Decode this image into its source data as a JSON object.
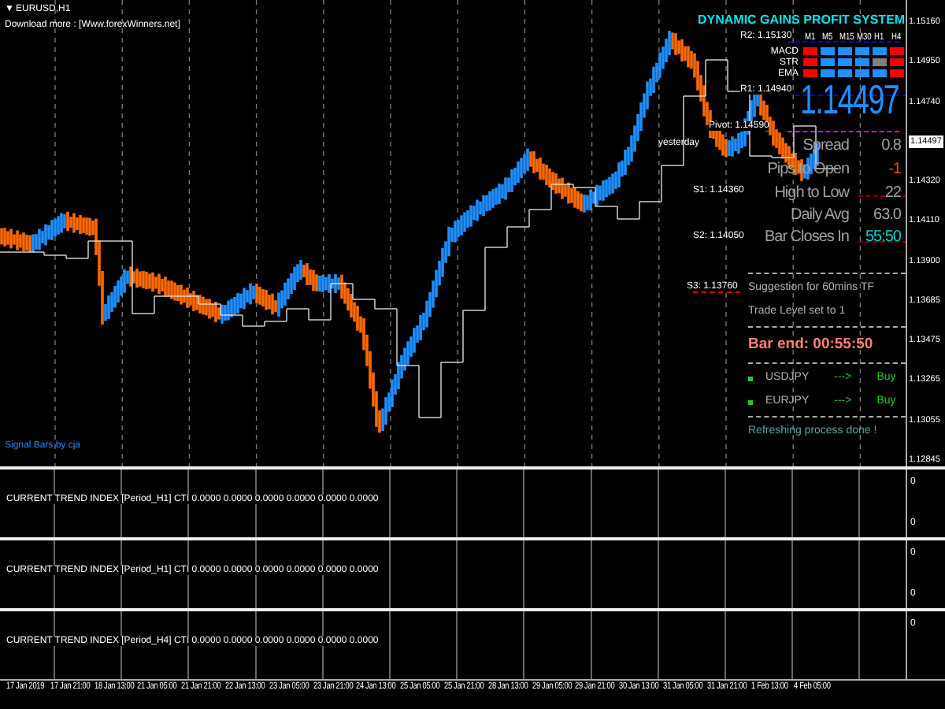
{
  "chart": {
    "symbol_marker": "▼",
    "symbol": "EURUSD,H1",
    "download_note": "Download more : [Www.forexWinners.net]",
    "signature": "Signal Bars by cja",
    "price_axis": [
      {
        "kind": "tick",
        "label": "1.15160"
      },
      {
        "kind": "tick",
        "label": "1.14950"
      },
      {
        "kind": "tick",
        "label": "1.14740"
      },
      {
        "kind": "current",
        "label": "1.14497"
      },
      {
        "kind": "tick",
        "label": "1.14320"
      },
      {
        "kind": "tick",
        "label": "1.14110"
      },
      {
        "kind": "tick",
        "label": "1.13900"
      },
      {
        "kind": "tick",
        "label": "1.13685"
      },
      {
        "kind": "tick",
        "label": "1.13475"
      },
      {
        "kind": "tick",
        "label": "1.13265"
      },
      {
        "kind": "tick",
        "label": "1.13055"
      },
      {
        "kind": "tick",
        "label": "1.12845"
      }
    ],
    "time_axis": [
      "17 Jan 2019",
      "17 Jan 21:00",
      "18 Jan 13:00",
      "21 Jan 05:00",
      "21 Jan 21:00",
      "22 Jan 13:00",
      "23 Jan 05:00",
      "23 Jan 21:00",
      "24 Jan 13:00",
      "25 Jan 05:00",
      "25 Jan 21:00",
      "28 Jan 13:00",
      "29 Jan 05:00",
      "29 Jan 21:00",
      "30 Jan 13:00",
      "31 Jan 05:00",
      "31 Jan 21:00",
      "1 Feb 13:00",
      "4 Feb 05:00"
    ]
  },
  "dashboard": {
    "title": "DYNAMIC GAINS PROFIT SYSTEM",
    "timeframes": [
      "M1",
      "M5",
      "M15",
      "M30",
      "H1",
      "H4"
    ],
    "indicators": [
      {
        "name": "MACD",
        "cells": [
          {
            "color": "#ff0000"
          },
          {
            "color": "#1e90ff"
          },
          {
            "color": "#1e90ff"
          },
          {
            "color": "#1e90ff"
          },
          {
            "color": "#1e90ff"
          },
          {
            "color": "#ff0000"
          }
        ]
      },
      {
        "name": "STR",
        "cells": [
          {
            "color": "#ff0000"
          },
          {
            "color": "#1e90ff"
          },
          {
            "color": "#1e90ff"
          },
          {
            "color": "#1e90ff"
          },
          {
            "color": "#808080"
          },
          {
            "color": "#ff0000"
          }
        ]
      },
      {
        "name": "EMA",
        "cells": [
          {
            "color": "#ff0000"
          },
          {
            "color": "#1e90ff"
          },
          {
            "color": "#1e90ff"
          },
          {
            "color": "#1e90ff"
          },
          {
            "color": "#1e90ff"
          },
          {
            "color": "#ff0000"
          }
        ]
      }
    ],
    "price": "1.14497",
    "levels": [
      {
        "label": "R2: 1.15130",
        "color": "#0000ff"
      },
      {
        "label": "R1: 1.14940",
        "color": "#0000ff"
      },
      {
        "label": "Pivot: 1.14590",
        "color": "#ff00ff"
      },
      {
        "label": "S1: 1.14360",
        "color": "#8b0000"
      },
      {
        "label": "S2: 1.14050",
        "color": "#8b0000"
      },
      {
        "label": "S3: 1.13760",
        "color": "#ff0000"
      }
    ],
    "yesterday_label": "yesterday",
    "stats": [
      {
        "label": "Spread",
        "value": "0.8",
        "color": "#a0a0a0"
      },
      {
        "label": "Pips to Open",
        "value": "-1",
        "color": "#ff4500"
      },
      {
        "label": "High to Low",
        "value": "22",
        "color": "#a0a0a0"
      },
      {
        "label": "Daily Avg",
        "value": "63.0",
        "color": "#a0a0a0"
      },
      {
        "label": "Bar Closes In",
        "value": "55:50",
        "color": "#00ced1"
      }
    ]
  },
  "signal_box": {
    "suggestion": "Suggestion for 60mins TF",
    "trade_level": "Trade Level set to 1",
    "bar_end": "Bar end: 00:55:50",
    "pairs": [
      {
        "symbol": "USDJPY",
        "arrow": "--->",
        "signal": "Buy"
      },
      {
        "symbol": "EURJPY",
        "arrow": "--->",
        "signal": "Buy"
      }
    ],
    "status": "Refreshing process done !"
  },
  "subwindows": [
    {
      "label": "CURRENT TREND INDEX [Period_H1] CTI 0.0000 0.0000 0.0000 0.0000 0.0000 0.0000",
      "axis": [
        "0",
        "0"
      ]
    },
    {
      "label": "CURRENT TREND INDEX [Period_H1] CTI 0.0000 0.0000 0.0000 0.0000 0.0000 0.0000",
      "axis": [
        "0",
        "0"
      ]
    },
    {
      "label": "CURRENT TREND INDEX [Period_H4] CTI 0.0000 0.0000 0.0000 0.0000 0.0000 0.0000",
      "axis": [
        "0"
      ]
    }
  ]
}
